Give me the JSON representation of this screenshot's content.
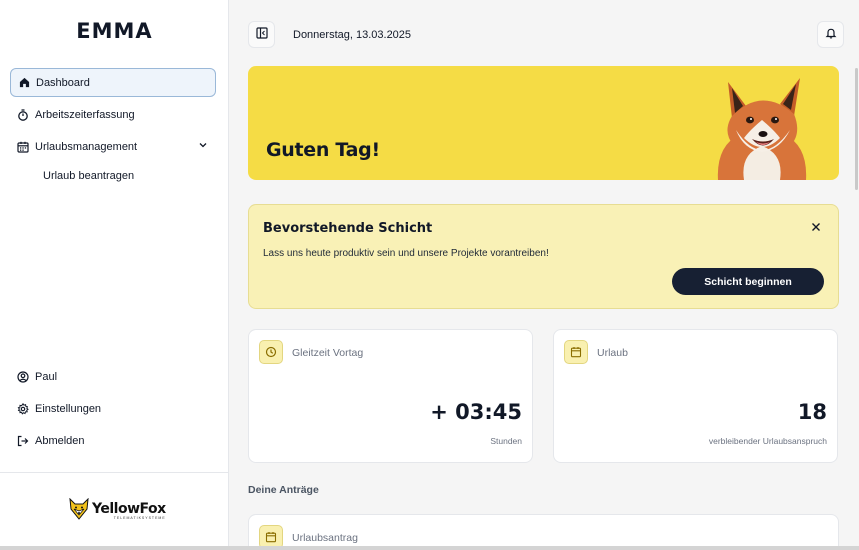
{
  "app": {
    "title": "EMMA"
  },
  "sidebar": {
    "items": [
      {
        "label": "Dashboard",
        "icon": "home-icon",
        "active": true
      },
      {
        "label": "Arbeitszeiterfassung",
        "icon": "stopwatch-icon"
      },
      {
        "label": "Urlaubsmanagement",
        "icon": "calendar-icon",
        "expanded": true
      }
    ],
    "sub_items": [
      {
        "label": "Urlaub beantragen"
      }
    ],
    "bottom_items": [
      {
        "label": "Paul",
        "icon": "user-circle-icon"
      },
      {
        "label": "Einstellungen",
        "icon": "gear-icon"
      },
      {
        "label": "Abmelden",
        "icon": "logout-icon"
      }
    ],
    "logo": {
      "name": "YellowFox",
      "tagline": "TELEMATIKSYSTEME",
      "icon": "fox-logo-icon"
    }
  },
  "header": {
    "date": "Donnerstag, 13.03.2025"
  },
  "hero": {
    "greeting": "Guten Tag!",
    "image": "fox-illustration"
  },
  "shift": {
    "title": "Bevorstehende Schicht",
    "text": "Lass uns heute produktiv sein und unsere Projekte vorantreiben!",
    "button": "Schicht beginnen"
  },
  "cards": [
    {
      "label": "Gleitzeit Vortag",
      "value": "+ 03:45",
      "unit": "Stunden",
      "icon": "clock-icon"
    },
    {
      "label": "Urlaub",
      "value": "18",
      "unit": "verbleibender Urlaubsanspruch",
      "icon": "calendar-icon"
    }
  ],
  "requests": {
    "section_label": "Deine Anträge",
    "items": [
      {
        "label": "Urlaubsantrag",
        "icon": "calendar-icon"
      }
    ]
  },
  "colors": {
    "accent_yellow": "#f5dc45",
    "light_yellow": "#f9f1b6",
    "dark_button": "#172033"
  }
}
